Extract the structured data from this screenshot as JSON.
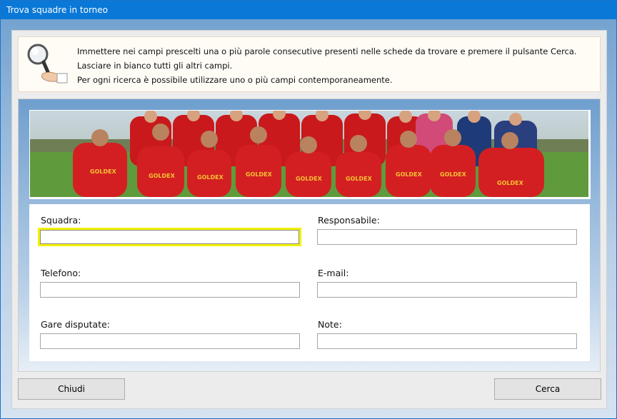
{
  "window": {
    "title": "Trova squadre in torneo"
  },
  "info": {
    "lines": [
      "Immettere nei campi prescelti una o più parole consecutive presenti nelle schede da trovare e premere il pulsante Cerca.",
      "Lasciare in bianco tutti gli altri campi.",
      "Per ogni ricerca è possibile utilizzare uno o più campi contemporaneamente."
    ]
  },
  "fields": {
    "squadra": {
      "label": "Squadra:",
      "value": ""
    },
    "responsabile": {
      "label": "Responsabile:",
      "value": ""
    },
    "telefono": {
      "label": "Telefono:",
      "value": ""
    },
    "email": {
      "label": "E-mail:",
      "value": ""
    },
    "gare": {
      "label": "Gare disputate:",
      "value": ""
    },
    "note": {
      "label": "Note:",
      "value": ""
    }
  },
  "buttons": {
    "close": "Chiudi",
    "search": "Cerca"
  },
  "icons": {
    "search": "magnifier-hand-icon",
    "banner": "team-photo-banner"
  },
  "colors": {
    "titlebar": "#0a78d7",
    "focus": "#f2f200",
    "jersey": "#d41f22"
  }
}
